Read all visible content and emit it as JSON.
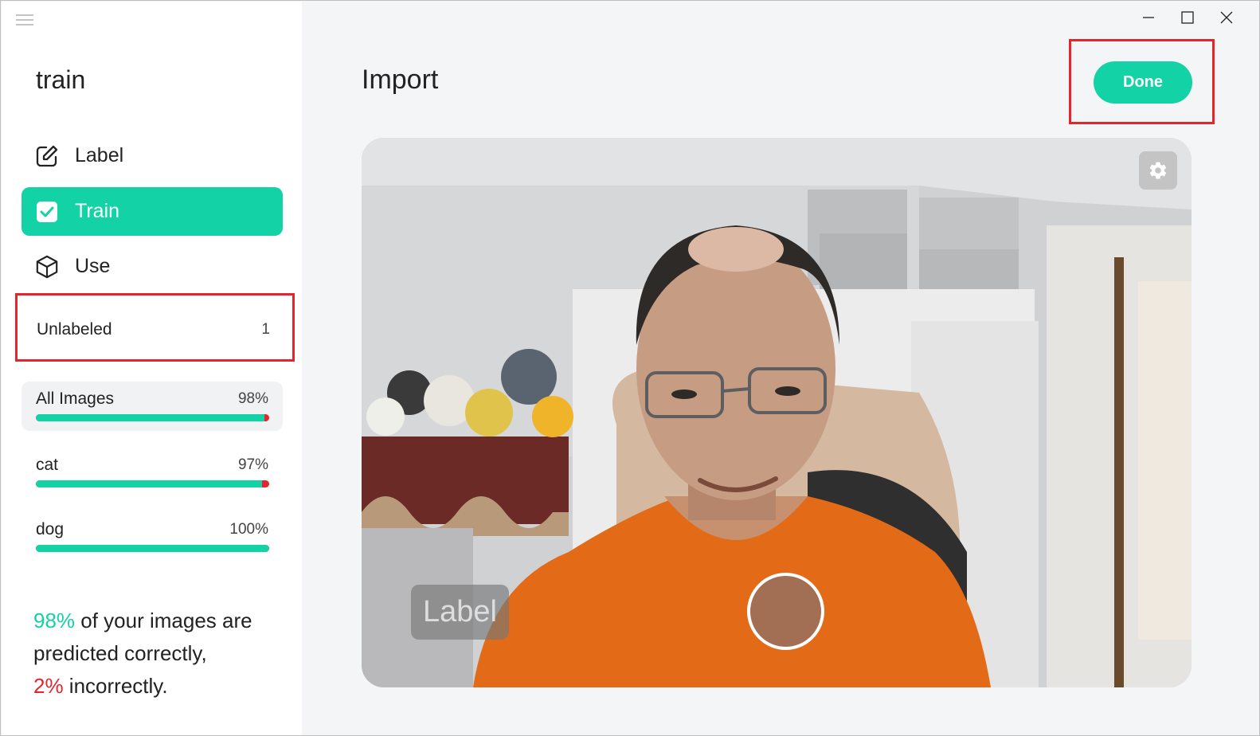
{
  "app": {
    "menu_icon": "hamburger-menu-icon",
    "project_name": "train"
  },
  "window_controls": {
    "minimize_icon": "minimize-icon",
    "maximize_icon": "maximize-icon",
    "close_icon": "close-icon"
  },
  "nav": {
    "items": [
      {
        "label": "Label",
        "icon": "pencil-square-icon",
        "active": false
      },
      {
        "label": "Train",
        "icon": "checkbox-icon",
        "active": true
      },
      {
        "label": "Use",
        "icon": "cube-icon",
        "active": false
      }
    ]
  },
  "unlabeled": {
    "label": "Unlabeled",
    "count": "1"
  },
  "stats": [
    {
      "name": "All Images",
      "percent_text": "98%",
      "accuracy": 0.98
    },
    {
      "name": "cat",
      "percent_text": "97%",
      "accuracy": 0.97
    },
    {
      "name": "dog",
      "percent_text": "100%",
      "accuracy": 1.0
    }
  ],
  "summary": {
    "correct_pct": "98%",
    "correct_text": " of your images are predicted correctly,",
    "incorrect_pct": "2%",
    "incorrect_text": " incorrectly."
  },
  "main": {
    "title": "Import",
    "done_label": "Done",
    "camera": {
      "settings_icon": "gear-icon",
      "label_button": "Label"
    }
  },
  "colors": {
    "accent": "#13d3a6",
    "error": "#e5242b",
    "highlight_border": "#e5242b"
  }
}
